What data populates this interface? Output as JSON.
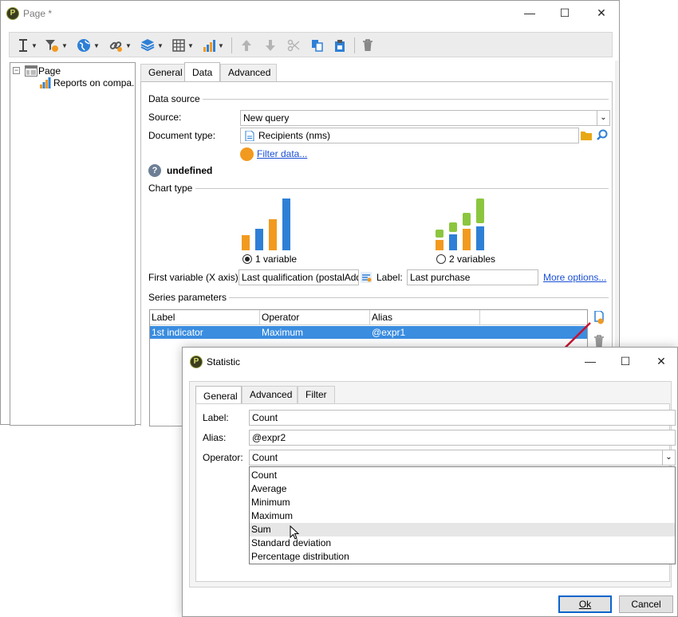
{
  "main_window": {
    "title": "Page *",
    "controls": {
      "minimize": "—",
      "maximize": "☐",
      "close": "✕"
    }
  },
  "toolbar": {
    "icons": [
      "text-cursor-icon",
      "filter-icon",
      "globe-icon",
      "link-icon",
      "cube-icon",
      "table-icon",
      "chart-icon",
      "arrow-up-icon",
      "arrow-down-icon",
      "scissors-icon",
      "copy-icon",
      "paste-icon",
      "trash-icon"
    ]
  },
  "tree": {
    "root": {
      "toggle": "−",
      "label": "Page"
    },
    "child": {
      "label": "Reports on compa..."
    }
  },
  "tabs": [
    "General",
    "Data",
    "Advanced"
  ],
  "data_tab": {
    "data_source_title": "Data source",
    "source_label": "Source:",
    "source_value": "New query",
    "doctype_label": "Document type:",
    "doctype_value": "Recipients (nms)",
    "filter_link": "Filter data...",
    "undefined_text": "undefined",
    "chart_type_title": "Chart type",
    "chart_option_1": "1 variable",
    "chart_option_2": "2 variables",
    "first_variable_label": "First variable (X axis):",
    "first_variable_value": "Last qualification (postalAdd",
    "label_label": "Label:",
    "label_value": "Last purchase",
    "more_options_link": "More options...",
    "series_title": "Series parameters",
    "series_columns": [
      "Label",
      "Operator",
      "Alias"
    ],
    "series_rows": [
      {
        "label": "1st indicator",
        "operator": "Maximum",
        "alias": "@expr1"
      }
    ]
  },
  "statistic_dialog": {
    "title": "Statistic",
    "controls": {
      "minimize": "—",
      "maximize": "☐",
      "close": "✕"
    },
    "tabs": [
      "General",
      "Advanced",
      "Filter"
    ],
    "label_field_label": "Label:",
    "label_field_value": "Count",
    "alias_field_label": "Alias:",
    "alias_field_value": "@expr2",
    "operator_field_label": "Operator:",
    "operator_field_value": "Count",
    "operator_options": [
      "Count",
      "Average",
      "Minimum",
      "Maximum",
      "Sum",
      "Standard deviation",
      "Percentage distribution"
    ],
    "hovered_option": "Sum",
    "ok_button": "Ok",
    "cancel_button": "Cancel"
  },
  "colors": {
    "selection": "#3b8de0",
    "link": "#1a4fd6",
    "chart_blue": "#2e80d6",
    "chart_orange": "#f29a1f",
    "chart_green": "#8cc63f",
    "arrow_red": "#c8102e"
  }
}
